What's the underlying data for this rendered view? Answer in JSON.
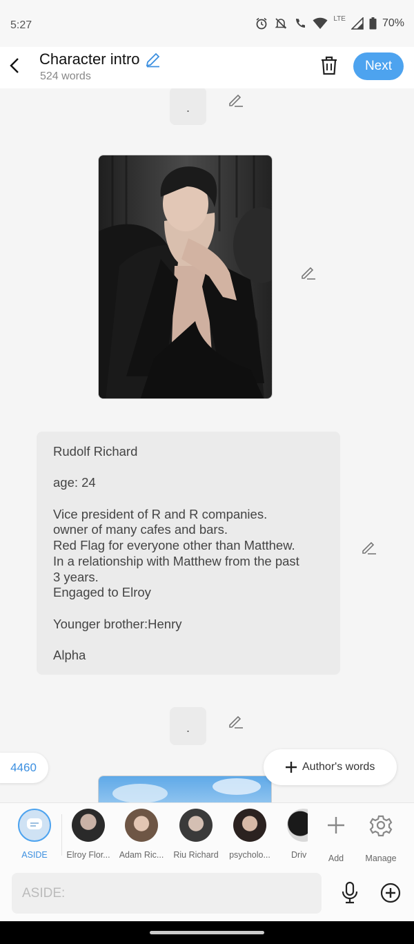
{
  "status_bar": {
    "time": "5:27",
    "network": "LTE",
    "battery": "70%"
  },
  "header": {
    "title": "Character intro",
    "word_count": "524 words",
    "next_label": "Next"
  },
  "content": {
    "separator_1": ".",
    "separator_2": ".",
    "bio_lines": [
      "Rudolf Richard",
      "",
      "age: 24",
      "",
      "Vice president of R and R companies.",
      "owner of many cafes and bars.",
      "Red Flag for everyone other than Matthew.",
      "In a relationship with Matthew from the past",
      "3 years.",
      "Engaged to Elroy",
      "",
      "Younger brother:Henry",
      "",
      "Alpha"
    ],
    "counter": "4460",
    "author_words_label": "Author's words"
  },
  "character_bar": {
    "aside_label": "ASIDE",
    "characters": [
      "Elroy Flor...",
      "Adam Ric...",
      "Riu Richard",
      "psycholo...",
      "Driv"
    ],
    "add_label": "Add",
    "manage_label": "Manage"
  },
  "input": {
    "placeholder": "ASIDE:"
  },
  "colors": {
    "accent": "#4da3ef",
    "background": "#f5f5f5",
    "bubble": "#ebebeb"
  }
}
